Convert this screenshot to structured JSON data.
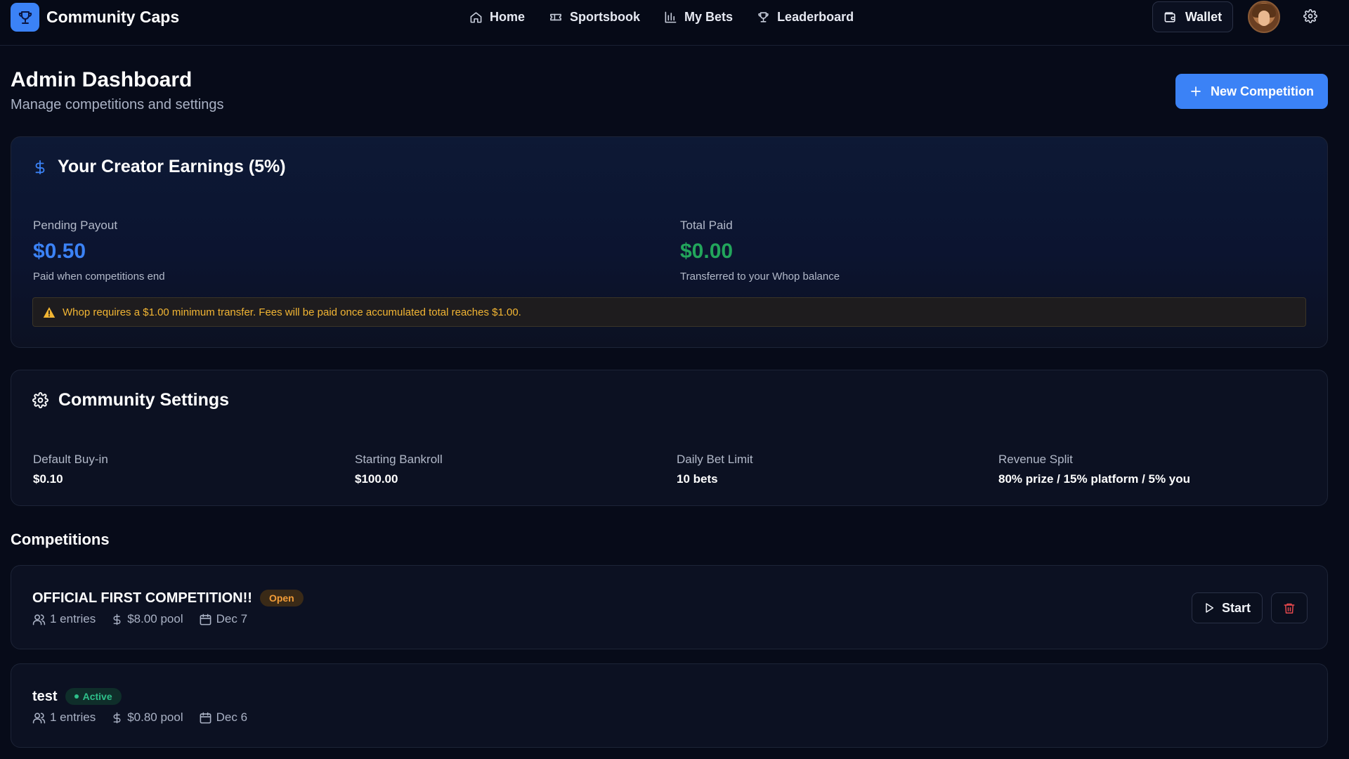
{
  "brand": {
    "name": "Community Caps",
    "logo_icon": "trophy-icon",
    "accent": "#3b82f6"
  },
  "nav": {
    "items": [
      {
        "label": "Home",
        "icon": "home-icon"
      },
      {
        "label": "Sportsbook",
        "icon": "ticket-icon"
      },
      {
        "label": "My Bets",
        "icon": "bar-chart-icon"
      },
      {
        "label": "Leaderboard",
        "icon": "trophy-icon"
      }
    ],
    "wallet_label": "Wallet"
  },
  "header": {
    "title": "Admin Dashboard",
    "subtitle": "Manage competitions and settings",
    "new_competition_label": "New Competition"
  },
  "earnings": {
    "title": "Your Creator Earnings (5%)",
    "pending": {
      "label": "Pending Payout",
      "value": "$0.50",
      "note": "Paid when competitions end",
      "color": "#3b82f6"
    },
    "paid": {
      "label": "Total Paid",
      "value": "$0.00",
      "note": "Transferred to your Whop balance",
      "color": "#22a55b"
    },
    "warning": "Whop requires a $1.00 minimum transfer. Fees will be paid once accumulated total reaches $1.00.",
    "warning_color": "#f2b533"
  },
  "settings": {
    "title": "Community Settings",
    "items": [
      {
        "label": "Default Buy-in",
        "value": "$0.10"
      },
      {
        "label": "Starting Bankroll",
        "value": "$100.00"
      },
      {
        "label": "Daily Bet Limit",
        "value": "10 bets"
      },
      {
        "label": "Revenue Split",
        "value": "80% prize / 15% platform / 5% you"
      }
    ]
  },
  "competitions": {
    "title": "Competitions",
    "items": [
      {
        "name": "OFFICIAL FIRST COMPETITION!!",
        "status": "Open",
        "entries": "1 entries",
        "pool": "$8.00 pool",
        "date": "Dec 7",
        "start_label": "Start"
      },
      {
        "name": "test",
        "status": "Active",
        "entries": "1 entries",
        "pool": "$0.80 pool",
        "date": "Dec 6"
      }
    ]
  }
}
